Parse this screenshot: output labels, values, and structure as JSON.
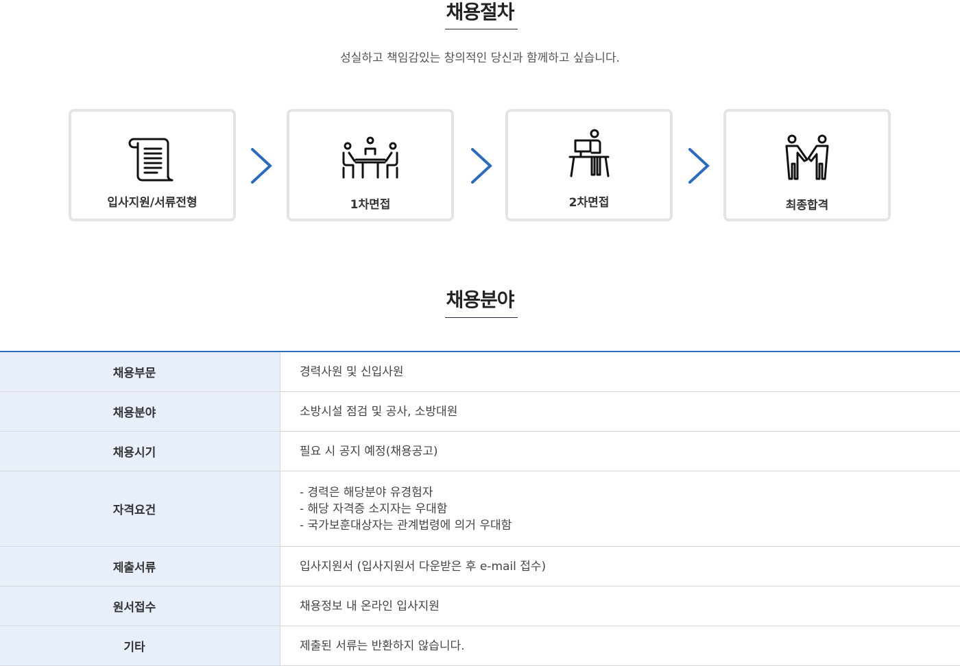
{
  "procedure": {
    "title": "채용절차",
    "subtitle": "성실하고 책임감있는 창의적인 당신과 함께하고 싶습니다.",
    "steps": [
      {
        "label": "입사지원/서류전형",
        "icon": "document-scroll-icon"
      },
      {
        "label": "1차면접",
        "icon": "interview-table-icon"
      },
      {
        "label": "2차면접",
        "icon": "desk-interview-icon"
      },
      {
        "label": "최종합격",
        "icon": "handshake-icon"
      }
    ],
    "arrow_icon": "chevron-right-icon",
    "accent_color": "#2b6bbf"
  },
  "field": {
    "title": "채용분야",
    "rows": [
      {
        "head": "채용부문",
        "lines": [
          "경력사원 및 신입사원"
        ]
      },
      {
        "head": "채용분야",
        "lines": [
          "소방시설 점검 및 공사, 소방대원"
        ]
      },
      {
        "head": "채용시기",
        "lines": [
          "필요 시 공지 예정(채용공고)"
        ]
      },
      {
        "head": "자격요건",
        "lines": [
          "- 경력은 해당분야 유경험자",
          "- 해당 자격증 소지자는 우대함",
          "- 국가보훈대상자는 관계법령에 의거 우대함"
        ]
      },
      {
        "head": "제출서류",
        "lines": [
          "입사지원서 (입사지원서 다운받은 후 e-mail 접수)"
        ]
      },
      {
        "head": "원서접수",
        "lines": [
          "채용정보 내 온라인 입사지원"
        ]
      },
      {
        "head": "기타",
        "lines": [
          "제출된 서류는 반환하지 않습니다."
        ]
      }
    ],
    "header_bg": "#e8effb",
    "border_top_color": "#2b6bbf"
  }
}
